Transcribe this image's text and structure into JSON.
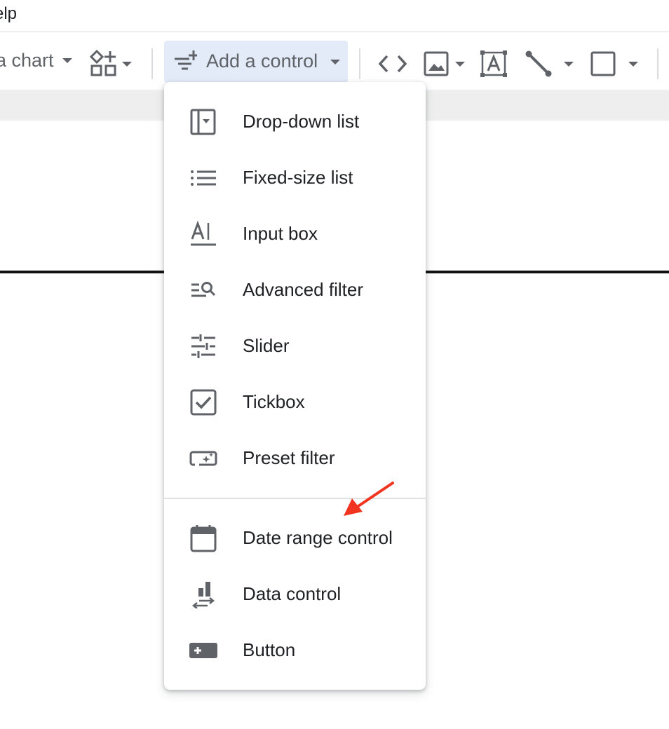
{
  "menubar": {
    "help_label": "elp"
  },
  "toolbar": {
    "chart_label": "a chart",
    "add_control_label": "Add a control"
  },
  "menu": {
    "items": [
      {
        "label": "Drop-down list",
        "icon": "dropdown-list-icon"
      },
      {
        "label": "Fixed-size list",
        "icon": "list-icon"
      },
      {
        "label": "Input box",
        "icon": "input-box-icon"
      },
      {
        "label": "Advanced filter",
        "icon": "advanced-filter-icon"
      },
      {
        "label": "Slider",
        "icon": "slider-icon"
      },
      {
        "label": "Tickbox",
        "icon": "checkbox-icon"
      },
      {
        "label": "Preset filter",
        "icon": "preset-filter-icon"
      },
      {
        "label": "Date range control",
        "icon": "calendar-icon"
      },
      {
        "label": "Data control",
        "icon": "data-control-icon"
      },
      {
        "label": "Button",
        "icon": "button-icon"
      }
    ]
  },
  "colors": {
    "icon_gray": "#5f6368",
    "selected_bg": "#e3ebf8",
    "arrow": "#f0341f"
  }
}
